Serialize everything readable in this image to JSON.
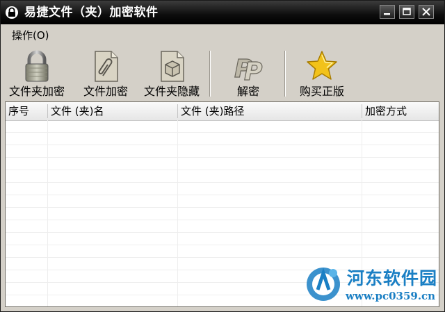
{
  "window": {
    "title": "易捷文件（夹）加密软件"
  },
  "menu": {
    "operate": "操作(O)"
  },
  "toolbar": {
    "items": [
      {
        "label": "文件夹加密",
        "icon": "padlock-icon"
      },
      {
        "label": "文件加密",
        "icon": "paperclip-document-icon"
      },
      {
        "label": "文件夹隐藏",
        "icon": "box-document-icon"
      },
      {
        "label": "解密",
        "icon": "pp-logo-icon"
      },
      {
        "label": "购买正版",
        "icon": "star-icon"
      }
    ]
  },
  "table": {
    "columns": [
      "序号",
      "文件 (夹)名",
      "文件 (夹)路径",
      "加密方式"
    ],
    "rows": []
  },
  "watermark": {
    "name": "河东软件园",
    "url": "www.pc0359.cn"
  },
  "colors": {
    "titlebar": "#000000",
    "window_bg": "#d4d0c8",
    "watermark": "#1a7fc4",
    "star": "#f2c21a"
  }
}
